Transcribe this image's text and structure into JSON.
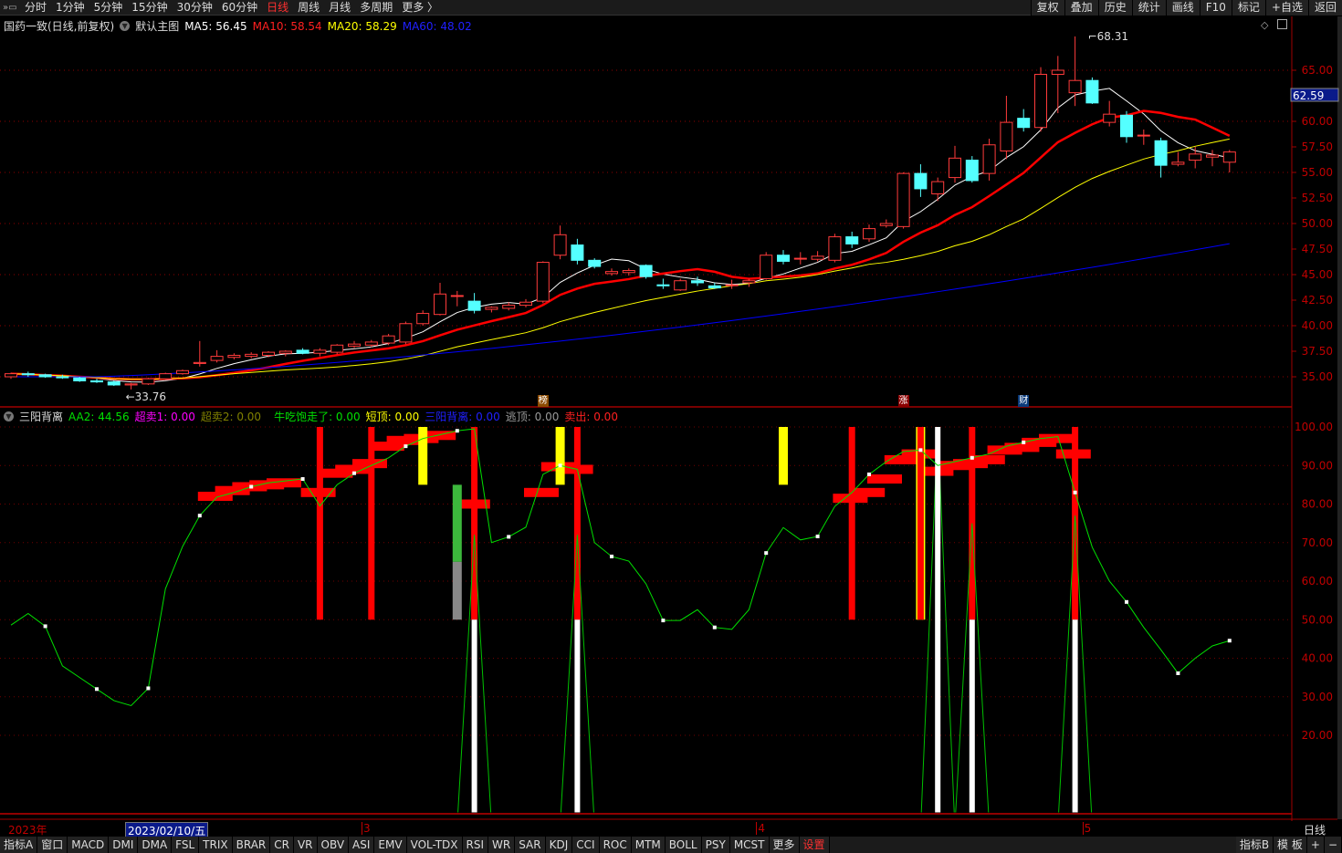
{
  "toolbar": {
    "left": [
      {
        "label": "分时"
      },
      {
        "label": "1分钟"
      },
      {
        "label": "5分钟"
      },
      {
        "label": "15分钟"
      },
      {
        "label": "30分钟"
      },
      {
        "label": "60分钟"
      },
      {
        "label": "日线",
        "active": true
      },
      {
        "label": "周线"
      },
      {
        "label": "月线"
      },
      {
        "label": "多周期"
      },
      {
        "label": "更多 〉"
      }
    ],
    "right": [
      {
        "label": "复权"
      },
      {
        "label": "叠加"
      },
      {
        "label": "历史"
      },
      {
        "label": "统计"
      },
      {
        "label": "画线"
      },
      {
        "label": "F10"
      },
      {
        "label": "标记"
      },
      {
        "label": "+自选"
      },
      {
        "label": "返回"
      }
    ]
  },
  "main_legend": {
    "title": "国药一致(日线,前复权)",
    "template": "默认主图",
    "ma5": "MA5: 56.45",
    "ma10": "MA10: 58.54",
    "ma20": "MA20: 58.29",
    "ma60": "MA60: 48.02"
  },
  "indicator_legend": {
    "name": "三阳背离",
    "aa2": "AA2: 44.56",
    "cm1": "超卖1: 0.00",
    "cm2": "超卖2: 0.00",
    "nc": "牛吃饱走了: 0.00",
    "dd": "短顶: 0.00",
    "sy": "三阳背离: 0.00",
    "td": "逃顶: 0.00",
    "mc": "卖出: 0.00"
  },
  "colors": {
    "up": "#ff3b3b",
    "down": "#54ffff",
    "ma5": "#ffffff",
    "ma10": "#ff0000",
    "ma20": "#ffff00",
    "ma60": "#0000ff",
    "aa2": "#00e000",
    "axis": "#c00000"
  },
  "annotations": {
    "high": "68.31",
    "low": "33.76",
    "current_price": "62.59"
  },
  "event_tags": [
    {
      "label": "榜",
      "color": "#8b4a00",
      "i": 31
    },
    {
      "label": "涨",
      "color": "#8b0000",
      "i": 52
    },
    {
      "label": "财",
      "color": "#0a3a7a",
      "i": 59
    }
  ],
  "x_axis": {
    "year": "2023年",
    "cursor_date": "2023/02/10/五",
    "months": [
      {
        "label": "3",
        "i": 20
      },
      {
        "label": "4",
        "i": 43
      },
      {
        "label": "5",
        "i": 62
      }
    ],
    "period": "日线"
  },
  "bottom_tabs": [
    {
      "label": "指标A"
    },
    {
      "label": "窗口"
    },
    {
      "label": "MACD"
    },
    {
      "label": "DMI"
    },
    {
      "label": "DMA"
    },
    {
      "label": "FSL"
    },
    {
      "label": "TRIX"
    },
    {
      "label": "BRAR"
    },
    {
      "label": "CR"
    },
    {
      "label": "VR"
    },
    {
      "label": "OBV"
    },
    {
      "label": "ASI"
    },
    {
      "label": "EMV"
    },
    {
      "label": "VOL-TDX"
    },
    {
      "label": "RSI"
    },
    {
      "label": "WR"
    },
    {
      "label": "SAR"
    },
    {
      "label": "KDJ"
    },
    {
      "label": "CCI"
    },
    {
      "label": "ROC"
    },
    {
      "label": "MTM"
    },
    {
      "label": "BOLL"
    },
    {
      "label": "PSY"
    },
    {
      "label": "MCST"
    },
    {
      "label": "更多"
    },
    {
      "label": "设置",
      "red": true
    }
  ],
  "bottom_right": [
    {
      "label": "指标B"
    },
    {
      "label": "模 板"
    },
    {
      "label": "+"
    },
    {
      "label": "−"
    }
  ],
  "chart_data": [
    {
      "type": "candlestick",
      "ylim": [
        33,
        70
      ],
      "yticks": [
        "65.00",
        "62.50",
        "60.00",
        "57.50",
        "55.00",
        "52.50",
        "50.00",
        "47.50",
        "45.00",
        "42.50",
        "40.00",
        "37.50",
        "35.00"
      ],
      "grid": "dotted-red",
      "ohlc": [
        [
          35.0,
          35.4,
          34.8,
          35.3
        ],
        [
          35.3,
          35.5,
          35.0,
          35.2
        ],
        [
          35.2,
          35.3,
          34.9,
          35.0
        ],
        [
          35.0,
          35.2,
          34.8,
          34.9
        ],
        [
          34.9,
          35.0,
          34.5,
          34.6
        ],
        [
          34.6,
          34.8,
          34.4,
          34.5
        ],
        [
          34.5,
          34.6,
          34.1,
          34.2
        ],
        [
          34.2,
          34.4,
          33.76,
          34.3
        ],
        [
          34.3,
          34.9,
          34.2,
          34.8
        ],
        [
          34.8,
          35.4,
          34.7,
          35.3
        ],
        [
          35.3,
          35.7,
          35.2,
          35.6
        ],
        [
          36.3,
          38.5,
          36.0,
          36.4
        ],
        [
          36.6,
          37.6,
          36.4,
          37.0
        ],
        [
          36.9,
          37.3,
          36.7,
          37.1
        ],
        [
          37.0,
          37.4,
          36.8,
          37.2
        ],
        [
          37.1,
          37.5,
          36.9,
          37.4
        ],
        [
          37.3,
          37.6,
          37.0,
          37.5
        ],
        [
          37.6,
          37.8,
          37.2,
          37.3
        ],
        [
          37.3,
          37.8,
          37.0,
          37.6
        ],
        [
          37.4,
          38.2,
          37.2,
          38.1
        ],
        [
          38.0,
          38.5,
          37.8,
          38.2
        ],
        [
          38.1,
          38.6,
          37.9,
          38.4
        ],
        [
          38.3,
          39.2,
          38.1,
          39.0
        ],
        [
          38.4,
          40.4,
          38.2,
          40.2
        ],
        [
          40.2,
          41.5,
          40.0,
          41.2
        ],
        [
          41.1,
          44.2,
          41.0,
          43.1
        ],
        [
          42.9,
          43.4,
          41.9,
          42.95
        ],
        [
          42.4,
          43.2,
          41.2,
          41.5
        ],
        [
          41.6,
          41.9,
          41.3,
          41.8
        ],
        [
          41.7,
          42.3,
          41.5,
          42.0
        ],
        [
          42.0,
          42.6,
          41.8,
          42.3
        ],
        [
          42.4,
          46.3,
          42.2,
          46.2
        ],
        [
          46.9,
          49.8,
          46.5,
          48.9
        ],
        [
          47.9,
          48.5,
          46.0,
          46.4
        ],
        [
          46.4,
          46.6,
          45.6,
          45.8
        ],
        [
          45.1,
          45.6,
          44.9,
          45.3
        ],
        [
          45.2,
          45.6,
          44.9,
          45.4
        ],
        [
          45.9,
          46.0,
          44.6,
          44.8
        ],
        [
          44.0,
          44.6,
          43.6,
          43.9
        ],
        [
          43.5,
          44.6,
          43.4,
          44.4
        ],
        [
          44.4,
          44.8,
          43.9,
          44.2
        ],
        [
          43.9,
          44.2,
          43.6,
          43.7
        ],
        [
          44.0,
          44.5,
          43.6,
          44.0
        ],
        [
          44.2,
          44.6,
          43.8,
          44.4
        ],
        [
          44.6,
          47.2,
          44.5,
          46.9
        ],
        [
          46.9,
          47.4,
          46.0,
          46.3
        ],
        [
          46.6,
          47.2,
          46.0,
          46.6
        ],
        [
          46.5,
          47.3,
          46.3,
          46.8
        ],
        [
          46.4,
          49.0,
          46.2,
          48.7
        ],
        [
          48.7,
          49.2,
          47.6,
          48.0
        ],
        [
          48.5,
          49.9,
          48.2,
          49.5
        ],
        [
          49.8,
          50.4,
          49.6,
          50.0
        ],
        [
          49.7,
          55.0,
          49.5,
          54.9
        ],
        [
          54.9,
          55.8,
          52.6,
          53.4
        ],
        [
          52.9,
          54.5,
          52.2,
          54.1
        ],
        [
          54.5,
          57.6,
          54.0,
          56.4
        ],
        [
          56.2,
          56.6,
          54.0,
          54.2
        ],
        [
          54.9,
          58.3,
          54.2,
          57.7
        ],
        [
          57.1,
          62.5,
          56.3,
          59.9
        ],
        [
          60.3,
          61.2,
          59.0,
          59.4
        ],
        [
          59.4,
          65.3,
          59.0,
          64.6
        ],
        [
          64.6,
          66.4,
          60.8,
          65.0
        ],
        [
          62.8,
          68.31,
          61.5,
          64.0
        ],
        [
          64.0,
          64.3,
          61.7,
          61.8
        ],
        [
          59.9,
          62.0,
          59.5,
          60.7
        ],
        [
          60.6,
          61.0,
          57.9,
          58.5
        ],
        [
          58.6,
          59.2,
          57.7,
          58.65
        ],
        [
          58.1,
          58.4,
          54.5,
          55.7
        ],
        [
          55.8,
          57.0,
          55.6,
          56.0
        ],
        [
          56.2,
          57.5,
          55.4,
          56.8
        ],
        [
          56.5,
          57.2,
          55.6,
          56.7
        ],
        [
          56.0,
          57.2,
          55.0,
          57.0
        ]
      ],
      "ma_periods": [
        5,
        10,
        20,
        60
      ]
    },
    {
      "type": "line",
      "name": "三阳背离",
      "ylim": [
        0,
        100
      ],
      "yticks": [
        "100.00",
        "90.00",
        "80.00",
        "70.00",
        "60.00",
        "50.00",
        "40.00",
        "30.00",
        "20.00"
      ],
      "aa2": [
        48.6,
        51.6,
        48.3,
        38,
        35,
        32,
        29,
        27.7,
        32.2,
        58,
        69,
        77,
        81.8,
        83,
        84.5,
        85.5,
        86,
        86.5,
        79.5,
        85,
        88,
        90,
        92,
        95,
        97,
        98,
        99,
        99.5,
        70,
        71.5,
        74,
        87.7,
        90,
        89,
        70,
        66.4,
        65.2,
        59.3,
        49.8,
        49.8,
        52.6,
        48,
        47.5,
        52.6,
        67.3,
        73.9,
        70.7,
        71.6,
        79.4,
        83,
        87.7,
        91,
        93.6,
        94,
        90,
        91,
        92,
        93,
        95,
        96,
        97,
        97.5,
        83,
        68.8,
        60,
        54.6,
        48,
        42.2,
        36.1,
        40,
        43.2,
        44.56
      ],
      "red_blocks": [
        [
          11,
          82
        ],
        [
          12,
          83.5
        ],
        [
          13,
          84.5
        ],
        [
          14,
          85
        ],
        [
          15,
          85.5
        ],
        [
          17,
          83
        ],
        [
          18,
          88
        ],
        [
          19,
          89
        ],
        [
          20,
          90.5
        ],
        [
          21,
          95
        ],
        [
          22,
          96.5
        ],
        [
          23,
          97
        ],
        [
          24,
          97.8
        ],
        [
          26,
          80
        ],
        [
          30,
          83
        ],
        [
          31,
          89.7
        ],
        [
          32,
          89
        ],
        [
          48,
          81.5
        ],
        [
          49,
          83
        ],
        [
          50,
          86.5
        ],
        [
          51,
          91.5
        ],
        [
          52,
          93
        ],
        [
          53,
          88.5
        ],
        [
          54,
          90
        ],
        [
          55,
          90.5
        ],
        [
          56,
          91.5
        ],
        [
          57,
          94
        ],
        [
          58,
          94.7
        ],
        [
          59,
          96
        ],
        [
          60,
          97
        ],
        [
          61,
          93
        ]
      ],
      "sell_bars": [
        18,
        21,
        27,
        33,
        49,
        53,
        56,
        62
      ],
      "top_bars": [
        [
          24,
          85
        ],
        [
          32,
          85
        ],
        [
          45,
          85
        ],
        [
          53,
          50
        ]
      ],
      "green_bar": {
        "i": 26,
        "green": [
          85,
          65
        ],
        "gray": [
          65,
          50
        ]
      },
      "spikes": [
        {
          "i": 27,
          "white": 50,
          "green": 72
        },
        {
          "i": 33,
          "white": 50,
          "green": 72
        },
        {
          "i": 54,
          "white": 100,
          "green": 100
        },
        {
          "i": 56,
          "white": 50,
          "green": 75
        },
        {
          "i": 62,
          "white": 50,
          "green": 77
        }
      ]
    }
  ]
}
